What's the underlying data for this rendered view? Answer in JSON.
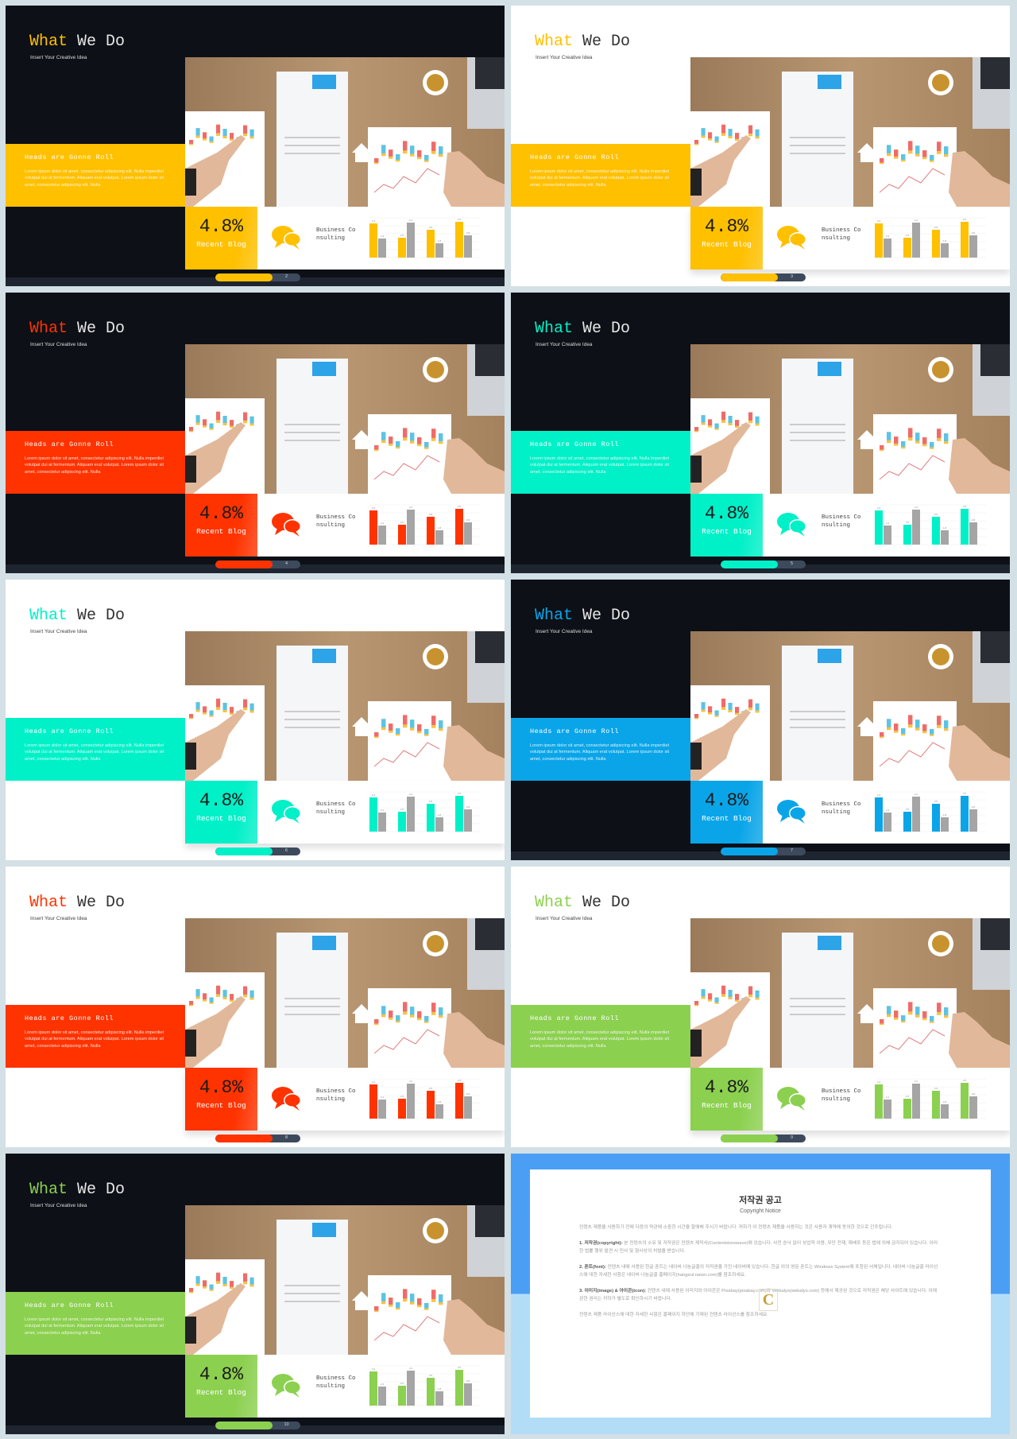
{
  "content": {
    "title_accent": "What",
    "title_rest": " We Do",
    "subtitle": "Insert Your Creative Idea",
    "band_heading": "Heads are Gonne Roll",
    "band_text": "Lorem ipsum dolor sit amet, consectetur adipiscing elit. Nulla imperdiet volutpat dui at fermentum. Aliquam erat volutpat. Lorem ipsum dolor sit amet, consectetur adipiscing elit. Nulla",
    "stat_value": "4.8%",
    "stat_label": "Recent Blog",
    "service_label": "Business Consulting",
    "icons": {
      "service": "chat-bubbles-icon",
      "photo_overlay": "house-icon"
    }
  },
  "chart_data": {
    "type": "bar",
    "series": [
      {
        "values": [
          4.3,
          2.5,
          3.5,
          4.5
        ],
        "color": "accent"
      },
      {
        "values": [
          2.4,
          4.4,
          1.8,
          2.8
        ],
        "color": "#a5a5a5"
      }
    ],
    "ylim": [
      0,
      5
    ],
    "grid": true
  },
  "slides": [
    {
      "theme": "dark",
      "accent": "#FFC000",
      "page": "2"
    },
    {
      "theme": "light",
      "accent": "#FFC000",
      "page": "3"
    },
    {
      "theme": "dark",
      "accent": "#FF3300",
      "page": "4"
    },
    {
      "theme": "dark",
      "accent": "#00F0C8",
      "page": "5"
    },
    {
      "theme": "light",
      "accent": "#00F0C8",
      "page": "6"
    },
    {
      "theme": "dark",
      "accent": "#0AA5E8",
      "page": "7"
    },
    {
      "theme": "light",
      "accent": "#FF3300",
      "page": "8"
    },
    {
      "theme": "light",
      "accent": "#8CD050",
      "page": "9"
    },
    {
      "theme": "dark",
      "accent": "#8CD050",
      "page": "10"
    }
  ],
  "copyright": {
    "title": "저작권 공고",
    "subtitle": "Copyright Notice",
    "intro": "컨텐츠 제품을 사용하기 전에 다음의 약관에 소중한 시간을 할애해 주시기 바랍니다. 귀하가 이 컨텐츠 제품을 사용하는 것은 사용자 계약에 동의한 것으로 간주됩니다.",
    "items": [
      {
        "head": "1. 저작권(copyright):",
        "text": " 본 컨텐츠의 소유 및 저작권은 컨텐츠 제작사(Contentstorewave)에 있습니다. 사전 승낙 없이 상업적 이용, 무단 전재, 재배포 등은 법에 의해 금지되어 있습니다. 이러한 법률 행위 발견 시 민사 및 형사상의 처벌을 받습니다."
      },
      {
        "head": "2. 폰트(font):",
        "text": " 컨텐츠 내에 사용된 한글 폰트는 네이버 나눔글꼴의 저작권을 가진 네이버에 있습니다. 한글 외의 영문 폰트는 Windows System에 포함된 서체입니다. 네이버 나눔글꼴 라이선스에 대한 자세한 사항은 네이버 나눔글꼴 홈페이지(hangeul.naver.com)를 참조하세요."
      },
      {
        "head": "3. 이미지(image) & 아이콘(icon):",
        "text": " 컨텐츠 내에 사용된 이미지와 아이콘은 Pixabay(pixabay.com)와 Webalys(webalys.com) 등에서 제공된 것으로 저작권은 해당 사이트에 있습니다. 이에 관한 권리는 귀하가 별도로 확인하시기 바랍니다."
      }
    ],
    "outro": "컨텐츠 제품 라이선스에 대한 자세한 사항은 홈페이지 하단에 기재된 컨텐츠 라이선스를 참조하세요."
  }
}
